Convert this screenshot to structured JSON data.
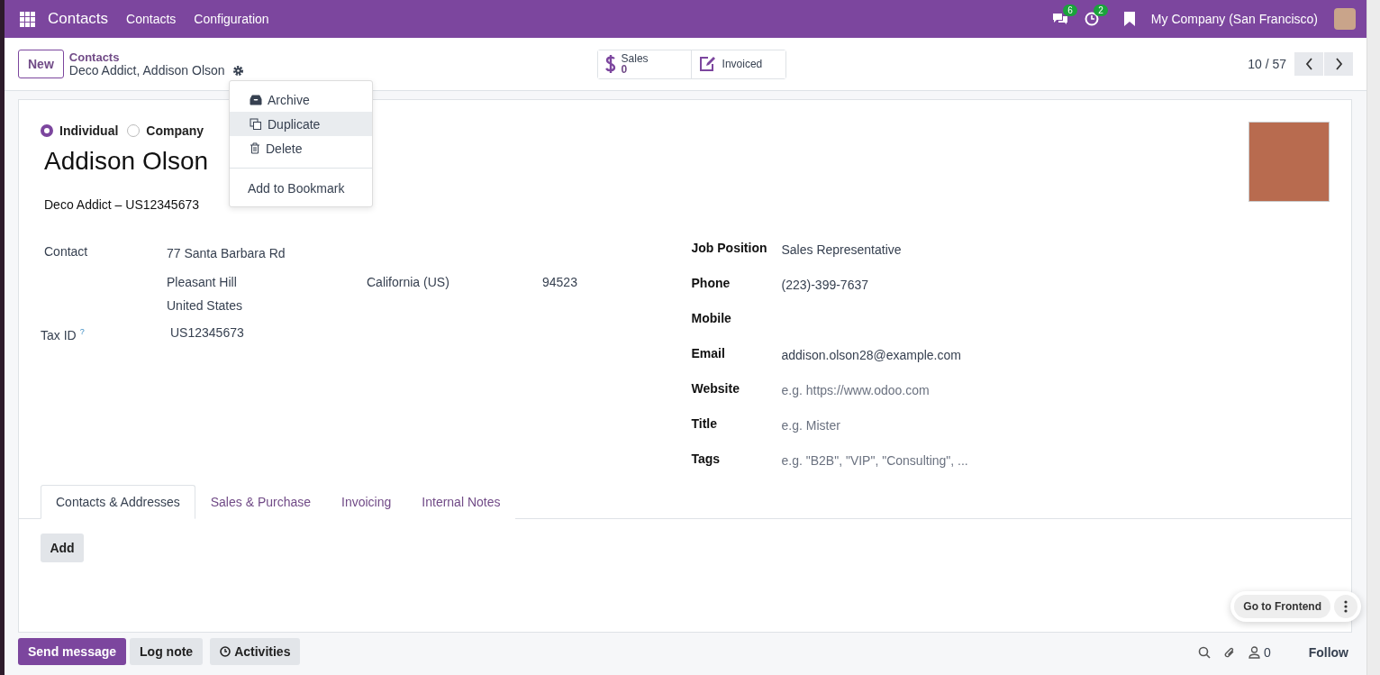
{
  "navbar": {
    "app_name": "Contacts",
    "menu": [
      "Contacts",
      "Configuration"
    ],
    "messages_count": "6",
    "activities_count": "2",
    "company": "My Company (San Francisco)"
  },
  "control_panel": {
    "new_button": "New",
    "breadcrumb_parent": "Contacts",
    "breadcrumb_current": "Deco Addict, Addison Olson",
    "smart_buttons": [
      {
        "kind": "stat",
        "label": "Sales",
        "value": "0"
      },
      {
        "kind": "plain",
        "label": "Invoiced"
      }
    ],
    "pager": "10 / 57"
  },
  "action_menu": {
    "items": [
      {
        "kind": "archive",
        "label": "Archive",
        "highlighted": false
      },
      {
        "kind": "duplicate",
        "label": "Duplicate",
        "highlighted": true
      },
      {
        "kind": "delete",
        "label": "Delete",
        "highlighted": false
      },
      {
        "kind": "bookmark",
        "label": "Add to Bookmark",
        "highlighted": false
      }
    ]
  },
  "form": {
    "company_type": [
      {
        "label": "Individual",
        "selected": true
      },
      {
        "label": "Company",
        "selected": false
      }
    ],
    "name": "Addison Olson",
    "company_line": "Deco Addict – US12345673",
    "address": {
      "label": "Contact",
      "street": "77 Santa Barbara Rd",
      "city": "Pleasant Hill",
      "state": "California (US)",
      "zip": "94523",
      "country": "United States"
    },
    "tax_id": {
      "label": "Tax ID",
      "help": "?",
      "value": "US12345673"
    },
    "right_fields": [
      {
        "label": "Job Position",
        "value": "Sales Representative"
      },
      {
        "label": "Phone",
        "value": "(223)-399-7637"
      },
      {
        "label": "Mobile"
      },
      {
        "label": "Email",
        "value": "addison.olson28@example.com"
      },
      {
        "label": "Website",
        "placeholder": "e.g. https://www.odoo.com"
      },
      {
        "label": "Title",
        "placeholder": "e.g. Mister"
      },
      {
        "label": "Tags",
        "placeholder": "e.g. \"B2B\", \"VIP\", \"Consulting\", ..."
      }
    ]
  },
  "tabs": [
    {
      "label": "Contacts & Addresses",
      "selected": true
    },
    {
      "label": "Sales & Purchase",
      "selected": false
    },
    {
      "label": "Invoicing",
      "selected": false
    },
    {
      "label": "Internal Notes",
      "selected": false
    }
  ],
  "add_button": "Add",
  "chatter": {
    "buttons": [
      {
        "kind": "primary",
        "label": "Send message"
      },
      {
        "kind": "secondary",
        "label": "Log note"
      },
      {
        "kind": "activities",
        "label": "Activities"
      }
    ],
    "followers_count": "0",
    "follow": "Follow"
  },
  "frontend_button": "Go to Frontend"
}
